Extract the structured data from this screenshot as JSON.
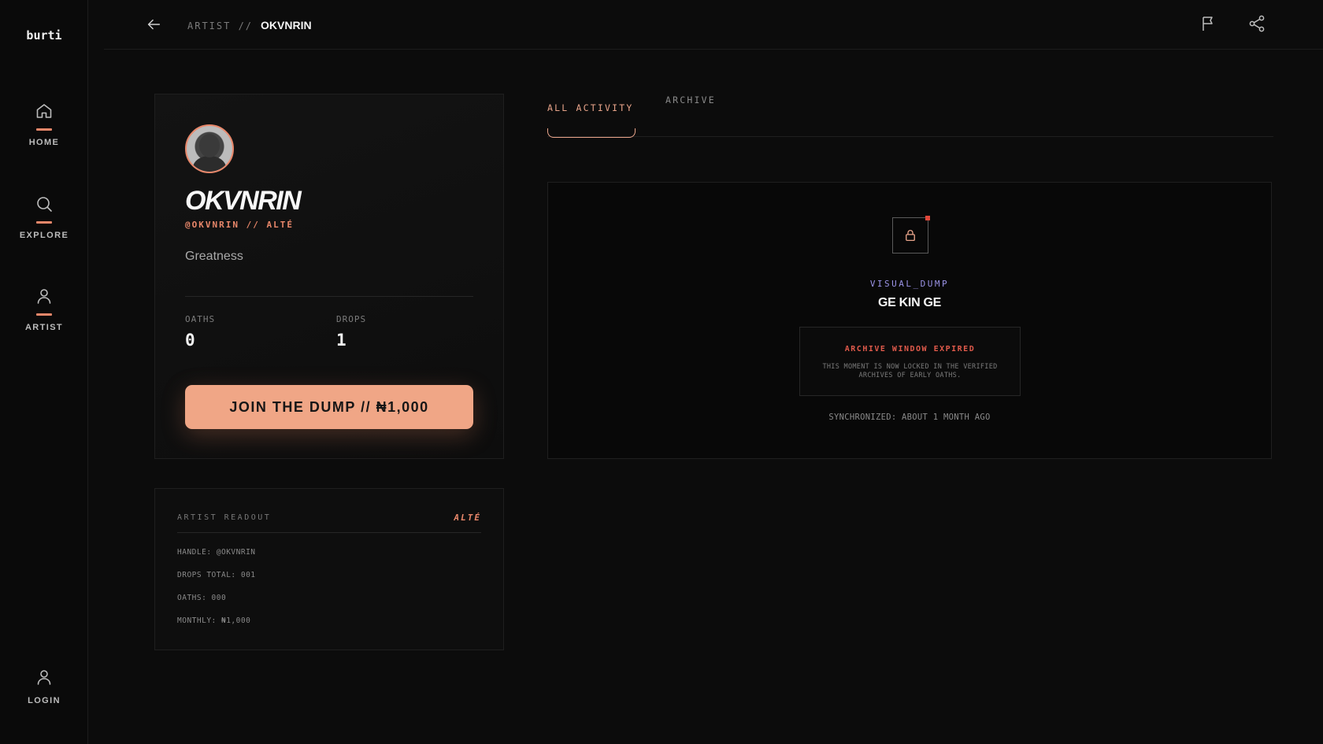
{
  "app": {
    "logo": "burti"
  },
  "sidebar": {
    "items": [
      {
        "label": "HOME",
        "icon": "home-icon"
      },
      {
        "label": "EXPLORE",
        "icon": "search-icon"
      },
      {
        "label": "ARTIST",
        "icon": "user-icon"
      }
    ],
    "login": {
      "label": "LOGIN",
      "icon": "user-icon"
    }
  },
  "header": {
    "breadcrumb_prefix": "ARTIST //",
    "breadcrumb_current": "OKVNRIN",
    "icons": [
      "back-arrow-icon",
      "flag-icon",
      "share-icon"
    ]
  },
  "profile": {
    "name": "OKVNRIN",
    "handle": "@OKVNRIN // ALTÉ",
    "bio": "Greatness",
    "stats": [
      {
        "label": "OATHS",
        "value": "0"
      },
      {
        "label": "DROPS",
        "value": "1"
      }
    ],
    "cta": "JOIN THE DUMP // ₦1,000"
  },
  "readout": {
    "title": "ARTIST READOUT",
    "genre": "ALTÉ",
    "rows": [
      "HANDLE: @OKVNRIN",
      "DROPS TOTAL: 001",
      "OATHS: 000",
      "MONTHLY: ₦1,000"
    ]
  },
  "tabs": [
    {
      "label": "ALL ACTIVITY",
      "active": true
    },
    {
      "label": "ARCHIVE",
      "active": false
    }
  ],
  "activity": {
    "type": "VISUAL_DUMP",
    "title": "GE KIN GE",
    "notice_title": "ARCHIVE WINDOW EXPIRED",
    "notice_body": "THIS MOMENT IS NOW LOCKED IN THE VERIFIED ARCHIVES OF EARLY OATHS.",
    "sync": "SYNCHRONIZED: ABOUT 1 MONTH AGO"
  },
  "colors": {
    "accent": "#e8876a",
    "cta": "#f0a686",
    "type_label": "#9b93e6",
    "alert": "#e05a4b"
  }
}
